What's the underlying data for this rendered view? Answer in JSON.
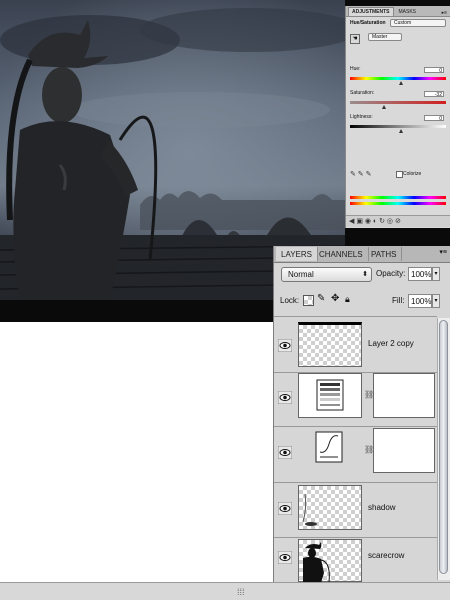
{
  "adjustments": {
    "tabs": [
      "ADJUSTMENTS",
      "MASKS"
    ],
    "title": "Hue/Saturation",
    "preset_value": "Custom",
    "channel_value": "Master",
    "hue_label": "Hue:",
    "hue_value": "0",
    "saturation_label": "Saturation:",
    "saturation_value": "-32",
    "lightness_label": "Lightness:",
    "lightness_value": "0",
    "colorize_label": "Colorize"
  },
  "layers_panel": {
    "tabs": [
      "LAYERS",
      "CHANNELS",
      "PATHS"
    ],
    "blend_mode": "Normal",
    "opacity_label": "Opacity:",
    "opacity_value": "100%",
    "lock_label": "Lock:",
    "fill_label": "Fill:",
    "fill_value": "100%",
    "layers": [
      {
        "name": "Layer 2 copy",
        "kind": "pixel"
      },
      {
        "name": "",
        "kind": "adjustment-levels"
      },
      {
        "name": "",
        "kind": "adjustment-curves"
      },
      {
        "name": "shadow",
        "kind": "pixel"
      },
      {
        "name": "scarecrow",
        "kind": "pixel"
      }
    ]
  },
  "status_bar": {
    "grip_glyph": "⁞⁞⁞"
  }
}
